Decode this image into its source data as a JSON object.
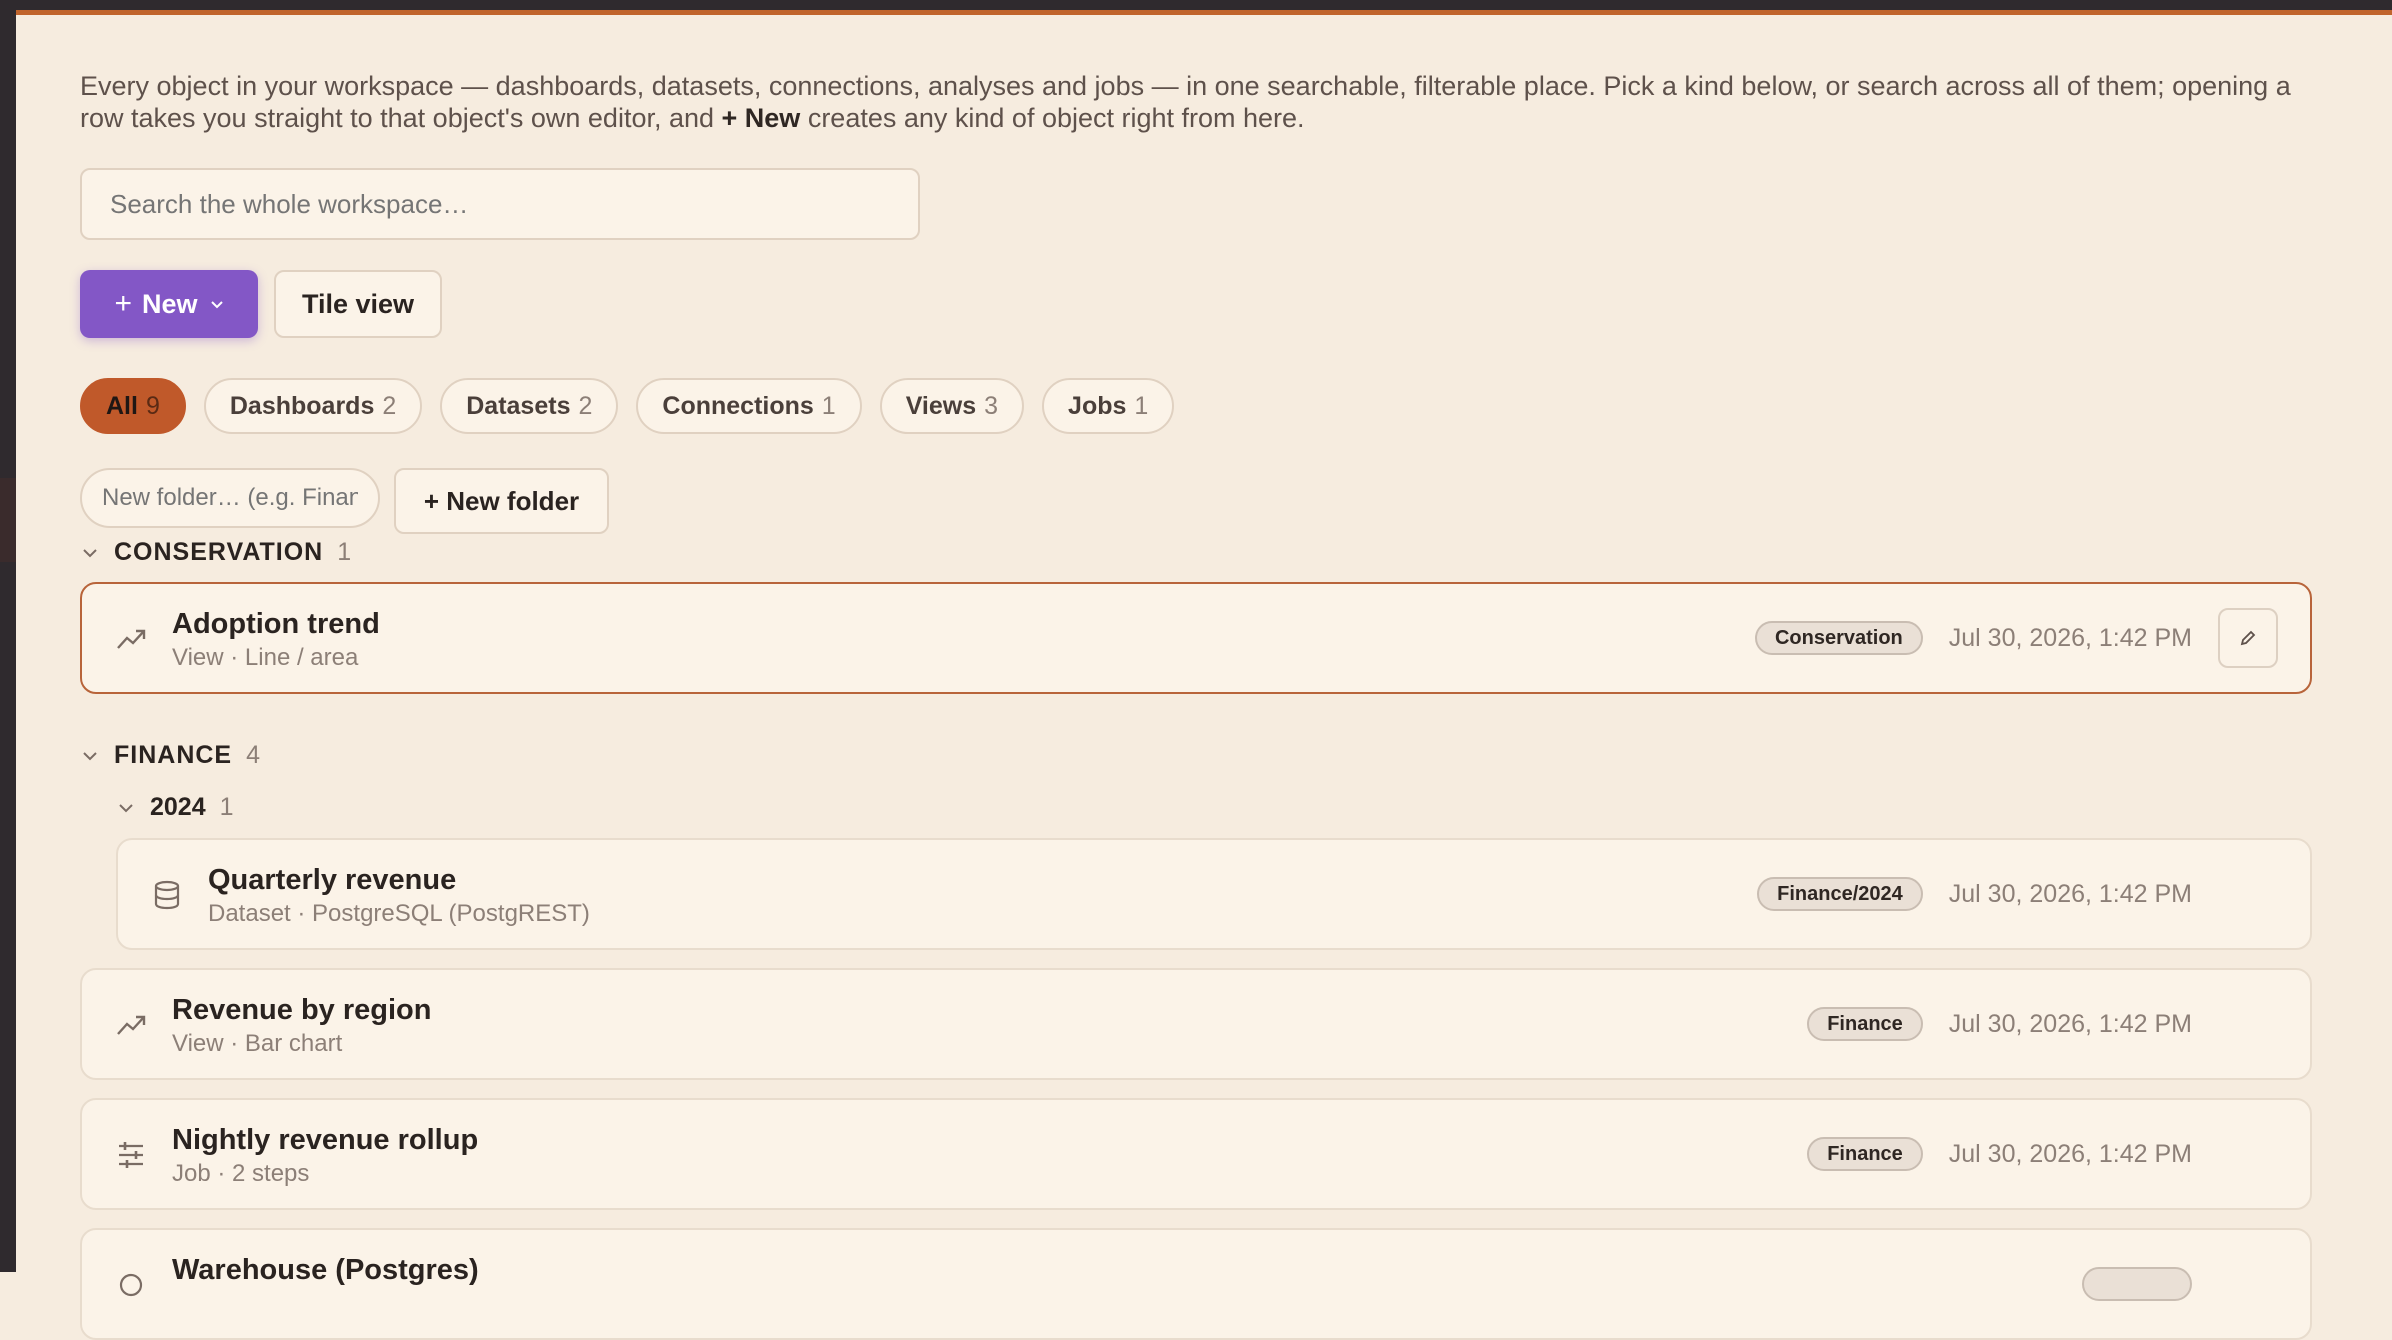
{
  "intro": {
    "text_before": "Every object in your workspace — dashboards, datasets, connections, analyses and jobs — in one searchable, filterable place. Pick a kind below, or search across all of them; opening a row takes you straight to that object's own editor, and ",
    "strong": "+ New",
    "text_after": " creates any kind of object right from here."
  },
  "search": {
    "placeholder": "Search the whole workspace…"
  },
  "toolbar": {
    "new_label": "New",
    "tile_view_label": "Tile view"
  },
  "filters": [
    {
      "label": "All",
      "count": "9",
      "active": true
    },
    {
      "label": "Dashboards",
      "count": "2"
    },
    {
      "label": "Datasets",
      "count": "2"
    },
    {
      "label": "Connections",
      "count": "1"
    },
    {
      "label": "Views",
      "count": "3"
    },
    {
      "label": "Jobs",
      "count": "1"
    }
  ],
  "folders": {
    "input_placeholder": "New folder… (e.g. Finance/2024)",
    "new_folder_label": "+ New folder"
  },
  "groups": {
    "conservation": {
      "name": "CONSERVATION",
      "count": "1",
      "items": [
        {
          "title": "Adoption trend",
          "subtitle": "View · Line / area",
          "tag": "Conservation",
          "date": "Jul 30, 2026, 1:42 PM",
          "icon": "trend-icon"
        }
      ]
    },
    "finance": {
      "name": "FINANCE",
      "count": "4",
      "sub_2024": {
        "name": "2024",
        "count": "1",
        "items": [
          {
            "title": "Quarterly revenue",
            "subtitle": "Dataset · PostgreSQL (PostgREST)",
            "tag": "Finance/2024",
            "date": "Jul 30, 2026, 1:42 PM",
            "icon": "database-icon"
          }
        ]
      },
      "items": [
        {
          "title": "Revenue by region",
          "subtitle": "View · Bar chart",
          "tag": "Finance",
          "date": "Jul 30, 2026, 1:42 PM",
          "icon": "trend-icon"
        },
        {
          "title": "Nightly revenue rollup",
          "subtitle": "Job · 2 steps",
          "tag": "Finance",
          "date": "Jul 30, 2026, 1:42 PM",
          "icon": "sliders-icon"
        },
        {
          "title": "Warehouse (Postgres)",
          "subtitle": "",
          "tag": "",
          "date": "",
          "icon": "connection-icon"
        }
      ]
    }
  },
  "colors": {
    "accent": "#c0592a",
    "primary": "#8357c6",
    "background": "#f6ecdf"
  }
}
